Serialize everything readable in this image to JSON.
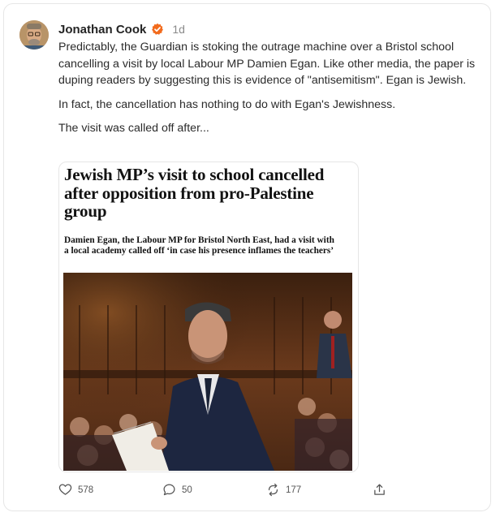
{
  "post": {
    "author": "Jonathan Cook",
    "time": "1d",
    "paragraphs": [
      "Predictably, the Guardian is stoking the outrage machine over a Bristol school cancelling a visit by local Labour MP Damien Egan. Like other media, the paper is duping readers by suggesting this is evidence of \"antisemitism\". Egan is Jewish.",
      "In fact, the cancellation has nothing to do with Egan's Jewishness.",
      "The visit was called off after..."
    ],
    "embed": {
      "headline": "Jewish MP’s visit to school cancelled after opposition from pro-Palestine group",
      "standfirst": "Damien Egan, the Labour MP for Bristol North East, had a visit with a local academy called off ‘in case his presence inflames the teachers’"
    },
    "actions": {
      "likes": "578",
      "replies": "50",
      "reposts": "177"
    }
  },
  "colors": {
    "verified_badge": "#f26b1d",
    "text": "#242424",
    "muted": "#8a8a8a"
  },
  "icons": [
    "verified-icon",
    "heart-icon",
    "comment-icon",
    "repost-icon",
    "share-icon"
  ]
}
